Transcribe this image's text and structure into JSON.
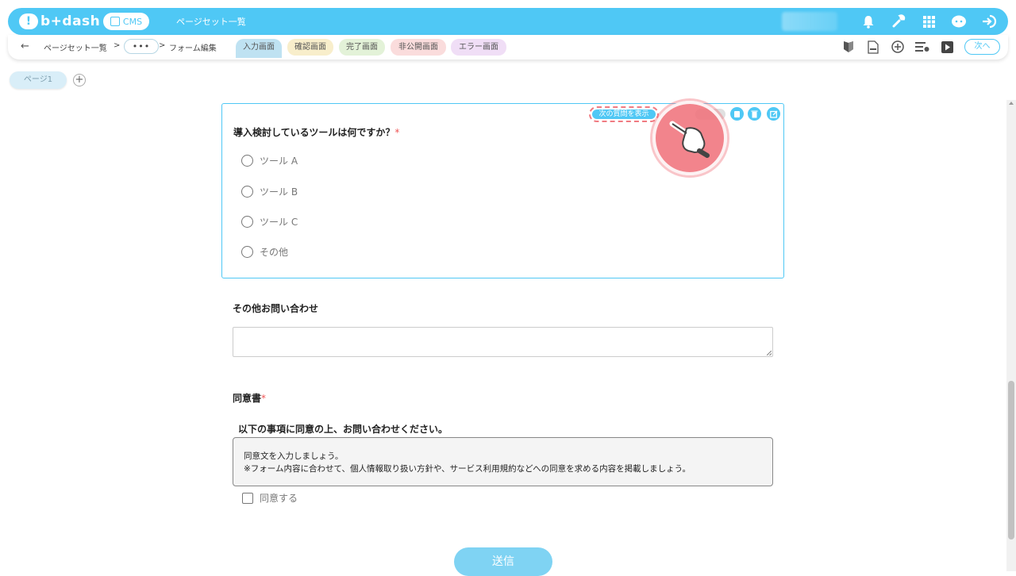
{
  "header": {
    "logo_text": "b+dash",
    "cms_label": "CMS",
    "title": "ページセット一覧"
  },
  "breadcrumb": {
    "item1": "ページセット一覧",
    "sep1": ">",
    "ellipsis": "•••",
    "sep2": ">",
    "item2": "フォーム編集"
  },
  "tabs": [
    {
      "label": "入力画面",
      "color": "#bfe2f2"
    },
    {
      "label": "確認画面",
      "color": "#f8eecb"
    },
    {
      "label": "完了画面",
      "color": "#e3f2d8"
    },
    {
      "label": "非公開画面",
      "color": "#fadcdc"
    },
    {
      "label": "エラー画面",
      "color": "#f0def6"
    }
  ],
  "next_label": "次へ",
  "page_tab": {
    "label": "ページ1",
    "add": "+"
  },
  "question": {
    "title": "導入検討しているツールは何ですか？",
    "required_mark": "*",
    "show_next_label": "次の質問を表示",
    "options": [
      "ツール A",
      "ツール B",
      "ツール C",
      "その他"
    ]
  },
  "other": {
    "label": "その他お問い合わせ"
  },
  "consent": {
    "label": "同意書",
    "required_mark": "*",
    "heading": "以下の事項に同意の上、お問い合わせください。",
    "line1": "同意文を入力しましょう。",
    "line2": "※フォーム内容に合わせて、個人情報取り扱い方針や、サービス利用規約などへの同意を求める内容を掲載しましょう。",
    "checkbox_label": "同意する"
  },
  "submit_label": "送信",
  "colors": {
    "accent": "#4fc8f5",
    "highlight": "#f07b82"
  }
}
